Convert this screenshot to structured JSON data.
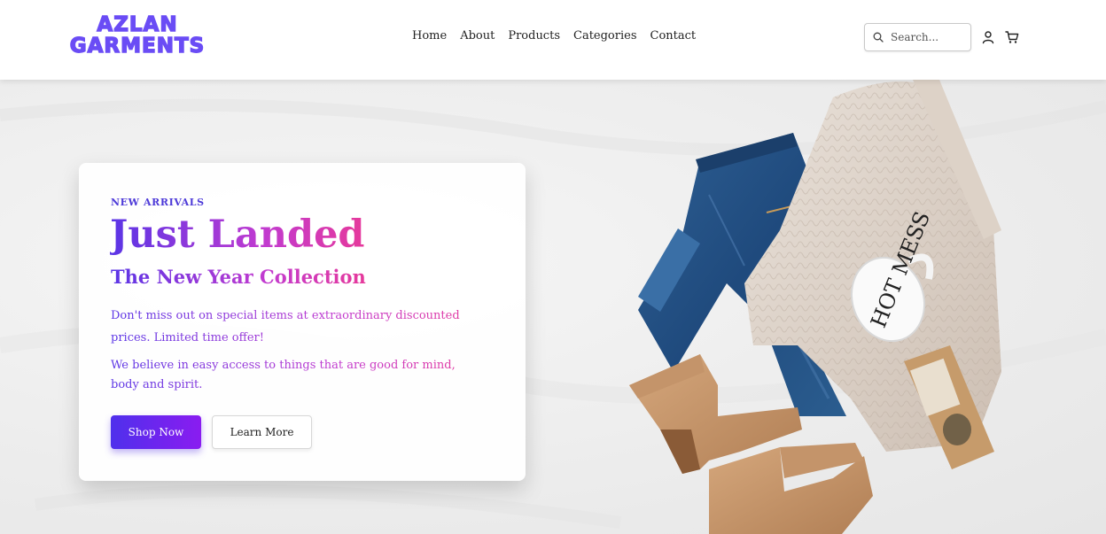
{
  "header": {
    "logo": {
      "line1": "AZLAN",
      "line2": "GARMENTS"
    },
    "nav": [
      "Home",
      "About",
      "Products",
      "Categories",
      "Contact"
    ],
    "search": {
      "placeholder": "Search...",
      "value": ""
    },
    "icons": [
      "search-icon",
      "user-icon",
      "cart-icon"
    ]
  },
  "hero": {
    "eyebrow": "NEW ARRIVALS",
    "title": "Just Landed",
    "subtitle": "The New Year Collection",
    "paragraph1": "Don't miss out on special items at extraordinary discounted prices. Limited time offer!",
    "paragraph2": "We believe in easy access to things that are good for mind, body and spirit.",
    "primary_button": "Shop Now",
    "secondary_button": "Learn More",
    "mug_text": "HOT MESS"
  },
  "colors": {
    "brand": "#6a4cf5",
    "gradient_start": "#5a35e6",
    "gradient_end": "#e6399b",
    "button_start": "#4f30ec",
    "button_end": "#8a1cf0"
  }
}
